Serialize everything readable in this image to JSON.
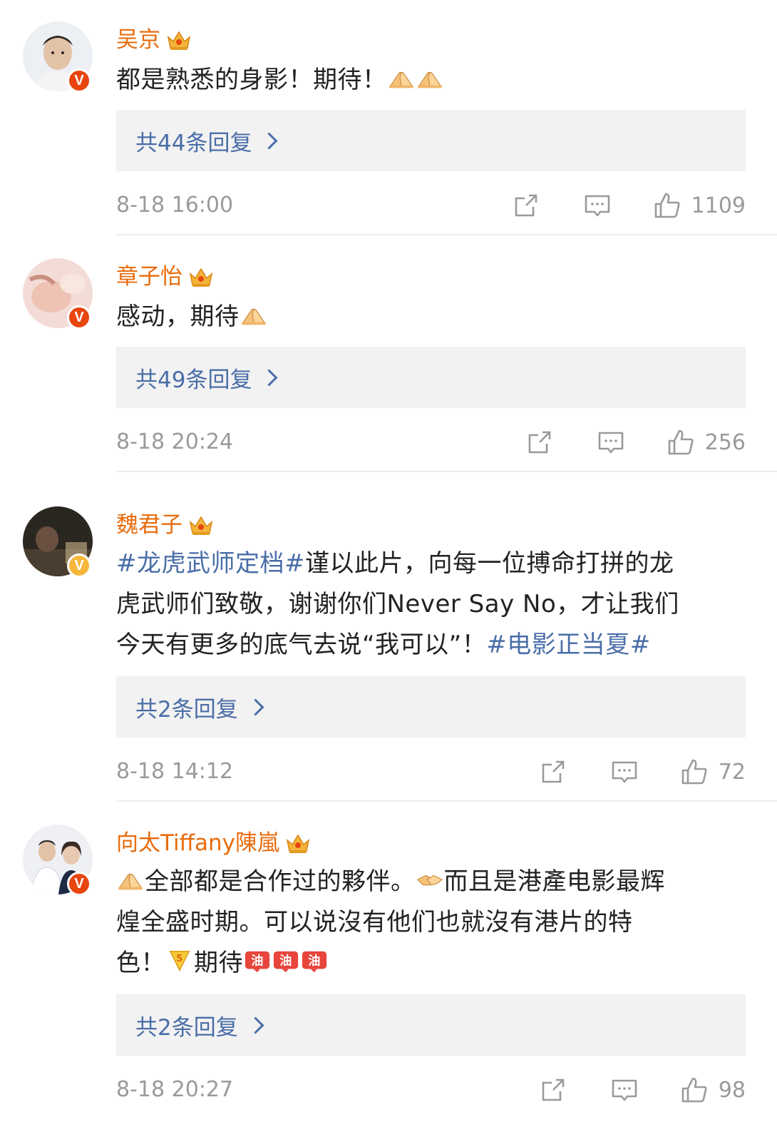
{
  "comments": [
    {
      "user": "吴京",
      "badge": "V",
      "badge_color": "#e8450f",
      "text_parts": [
        "都是熟悉的身影！期待！"
      ],
      "emojis": [
        "pray-hands",
        "pray-hands"
      ],
      "replies": "共44条回复",
      "time": "8-18 16:00",
      "likes": "1109"
    },
    {
      "user": "章子怡",
      "badge": "V",
      "badge_color": "#e8450f",
      "text_parts": [
        "感动，期待"
      ],
      "emojis": [
        "pray-hands"
      ],
      "replies": "共49条回复",
      "time": "8-18 20:24",
      "likes": "256"
    },
    {
      "user": "魏君子",
      "badge": "V",
      "badge_color": "#f6b73c",
      "hashtag1": "#龙虎武师定档#",
      "line1": "谨以此片，向每一位搏命打拼的龙",
      "line2": "虎武师们致敬，谢谢你们Never Say No，才让我们",
      "line3": "今天有更多的底气去说“我可以”！",
      "hashtag2": "#电影正当夏#",
      "replies": "共2条回复",
      "time": "8-18 14:12",
      "likes": "72"
    },
    {
      "user": "向太Tiffany陳嵐",
      "badge": "V",
      "badge_color": "#e8450f",
      "part1": "全部都是合作过的夥伴。",
      "part2": "而且是港產电影最辉",
      "line2": "煌全盛时期。可以说沒有他们也就沒有港片的特",
      "line3a": "色！",
      "line3b": "期待",
      "emojis": [
        "pray-hands",
        "handshake",
        "good-luck",
        "jiayou",
        "jiayou",
        "jiayou"
      ],
      "replies": "共2条回复",
      "time": "8-18 20:27",
      "likes": "98"
    }
  ],
  "icons": [
    "crown-icon",
    "share-icon",
    "comment-icon",
    "like-icon"
  ],
  "colors": {
    "username": "#e86b0c",
    "link": "#4a6ea8",
    "meta": "#9a9a9a",
    "reply_bg": "#f2f2f2"
  }
}
